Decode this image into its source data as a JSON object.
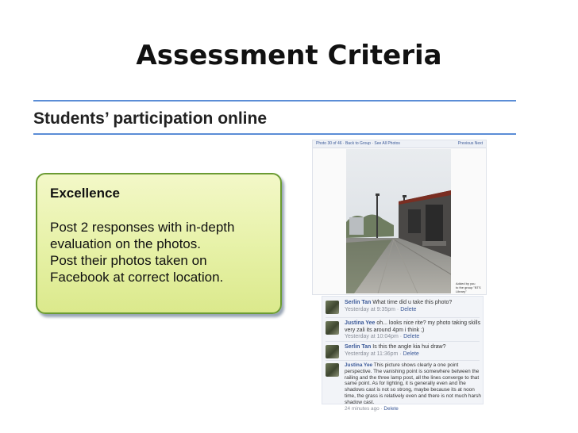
{
  "slide": {
    "title": "Assessment Criteria",
    "subtitle": "Students’ participation online"
  },
  "criteria": {
    "heading": "Excellence",
    "lines": [
      "Post 2 responses with in-depth",
      "evaluation on the photos.",
      "Post their photos taken on",
      "Facebook at correct location."
    ]
  },
  "photo_page": {
    "header_left": "Photo 30 of 46 · Back to Group · See All Photos",
    "header_right": "Previous  Next",
    "caption_line1": "Added by you",
    "caption_line2": "to the group \"BTS Library\""
  },
  "comments": [
    {
      "author": "Serlin Tan",
      "text": "What time did u take this photo?",
      "time": "Yesterday at 9:35pm",
      "action": "Delete"
    },
    {
      "author": "Justina Yee",
      "text": "oh... looks nice rite? my photo taking skills very zali its around 4pm i think ;)",
      "time": "Yesterday at 10:04pm",
      "action": "Delete"
    },
    {
      "author": "Serlin Tan",
      "text": "Is this the angle kia hui draw?",
      "time": "Yesterday at 11:36pm",
      "action": "Delete"
    },
    {
      "author": "Justina Yee",
      "text": "This picture shows clearly a one point perspective. The vanishing point is somewhere between the railing and the three lamp post, all the lines converge to that same point. As for lighting, it is generally even and the shadows cast is not so strong, maybe because its at noon time, the grass is relatively even and there is not much harsh shadow cast.",
      "time": "24 minutes ago",
      "action": "Delete"
    }
  ],
  "colors": {
    "rule": "#5b8dd6",
    "box_border": "#6b9b33",
    "box_fill": "#e6f1a6",
    "fb_link": "#3b5998"
  }
}
